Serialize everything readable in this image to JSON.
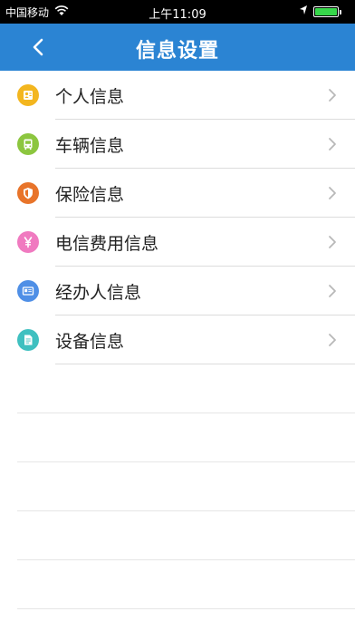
{
  "status_bar": {
    "carrier": "中国移动",
    "time": "上午11:09",
    "battery_level": 1.0
  },
  "nav": {
    "title": "信息设置"
  },
  "items": [
    {
      "label": "个人信息",
      "icon": "person-card-icon",
      "color": "#f3b61f"
    },
    {
      "label": "车辆信息",
      "icon": "bus-icon",
      "color": "#8cc63f"
    },
    {
      "label": "保险信息",
      "icon": "shield-icon",
      "color": "#e8742a"
    },
    {
      "label": "电信费用信息",
      "icon": "yen-icon",
      "color": "#f07ac0"
    },
    {
      "label": "经办人信息",
      "icon": "id-card-icon",
      "color": "#4f8fe6"
    },
    {
      "label": "设备信息",
      "icon": "document-icon",
      "color": "#3fc0c0"
    }
  ],
  "colors": {
    "nav_bg": "#2b84d3",
    "divider": "#dcdcdc",
    "chevron": "#b8b8b8"
  }
}
